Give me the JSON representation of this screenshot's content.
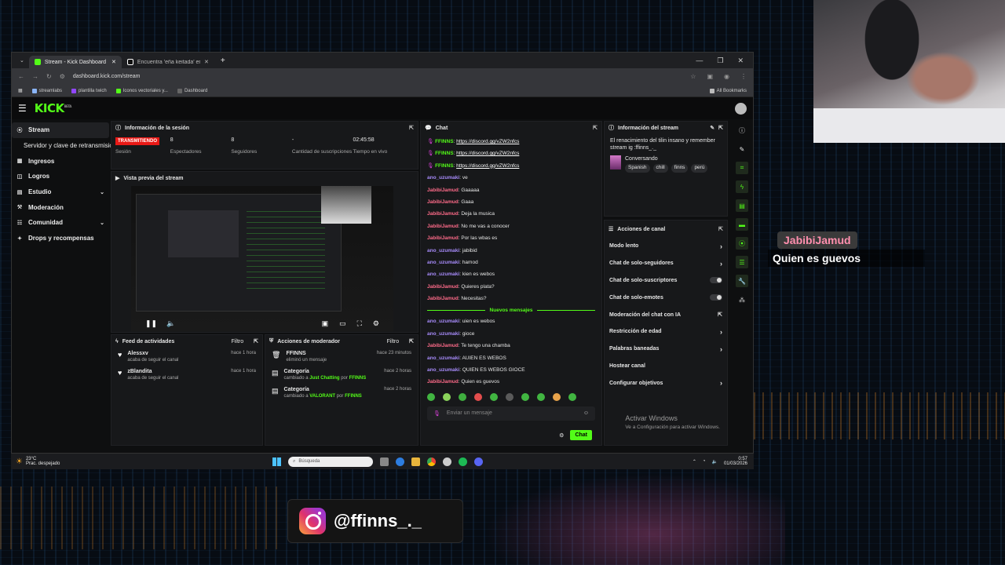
{
  "browser": {
    "tabs": [
      {
        "title": "Stream - Kick Dashboard",
        "active": true
      },
      {
        "title": "Encuentra 'eña keitada' en Tik",
        "active": false
      }
    ],
    "new_tab": "+",
    "url": "dashboard.kick.com/stream",
    "bookmarks": [
      "streamlabs",
      "plantilla twich",
      "Iconos vectoriales y...",
      "Dashboard"
    ],
    "all_bookmarks": "All Bookmarks"
  },
  "kick": {
    "logo": "KICK",
    "logo_badge": "BETA",
    "sidebar": [
      {
        "label": "Stream",
        "icon": "broadcast-icon",
        "active": true
      },
      {
        "label": "Servidor y clave de retransmisión",
        "sub": true
      },
      {
        "label": "Ingresos",
        "icon": "grid-icon"
      },
      {
        "label": "Logros",
        "icon": "trophy-icon"
      },
      {
        "label": "Estudio",
        "icon": "layout-icon",
        "expand": true
      },
      {
        "label": "Moderación",
        "icon": "gavel-icon"
      },
      {
        "label": "Comunidad",
        "icon": "group-icon",
        "expand": true
      },
      {
        "label": "Drops y recompensas",
        "icon": "gift-icon"
      }
    ],
    "session": {
      "title": "Información de la sesión",
      "status": "TRANSMITIENDO",
      "status_label": "Sesión",
      "stats": [
        {
          "value": "8",
          "label": "Espectadores"
        },
        {
          "value": "8",
          "label": "Seguidores"
        },
        {
          "value": "-",
          "label": "Cantidad de suscripciones"
        },
        {
          "value": "02:45:58",
          "label": "Tiempo en vivo"
        }
      ]
    },
    "preview": {
      "title": "Vista previa del stream"
    },
    "feed": {
      "title": "Feed de actividades",
      "filter": "Filtro",
      "items": [
        {
          "user": "Alessxv",
          "action": "acaba de seguir el canal",
          "time": "hace 1 hora"
        },
        {
          "user": "zBlandita",
          "action": "acaba de seguir el canal",
          "time": "hace 1 hora"
        }
      ]
    },
    "modactions": {
      "title": "Acciones de moderador",
      "filter": "Filtro",
      "items": [
        {
          "title": "FFINNS",
          "desc": "eliminó un mensaje",
          "time": "hace 23 minutos"
        },
        {
          "title": "Categoría",
          "desc_pre": "cambiado a ",
          "desc_hl": "Just Chatting",
          "desc_mid": " por ",
          "desc_by": "FFINNS",
          "time": "hace 2 horas"
        },
        {
          "title": "Categoría",
          "desc_pre": "cambiado a ",
          "desc_hl": "VALORANT",
          "desc_mid": " por ",
          "desc_by": "FFINNS",
          "time": "hace 2 horas"
        }
      ]
    },
    "chat": {
      "title": "Chat",
      "messages": [
        {
          "user": "FFINNS",
          "color": "#53fc18",
          "text": "https://discord.gg/vZW2nfcs",
          "link": true,
          "badge": true
        },
        {
          "user": "FFINNS",
          "color": "#53fc18",
          "text": "https://discord.gg/vZW2nfcs",
          "link": true,
          "badge": true
        },
        {
          "user": "FFINNS",
          "color": "#53fc18",
          "text": "https://discord.gg/vZW2nfcs",
          "link": true,
          "badge": true
        },
        {
          "user": "ano_uzumaki",
          "color": "#a78bfa",
          "text": "ve"
        },
        {
          "user": "JabibiJamud",
          "color": "#ff6b8a",
          "text": "Gaaaaa"
        },
        {
          "user": "JabibiJamud",
          "color": "#ff6b8a",
          "text": "Gaaa"
        },
        {
          "user": "JabibiJamud",
          "color": "#ff6b8a",
          "text": "Deja la musica"
        },
        {
          "user": "JabibiJamud",
          "color": "#ff6b8a",
          "text": "No me vas a conocer"
        },
        {
          "user": "JabibiJamud",
          "color": "#ff6b8a",
          "text": "Por las wbas es"
        },
        {
          "user": "ano_uzumaki",
          "color": "#a78bfa",
          "text": "jabibid"
        },
        {
          "user": "ano_uzumaki",
          "color": "#a78bfa",
          "text": "hamod"
        },
        {
          "user": "ano_uzumaki",
          "color": "#a78bfa",
          "text": "kien es webos"
        },
        {
          "user": "JabibiJamud",
          "color": "#ff6b8a",
          "text": "Quieres plata?"
        },
        {
          "user": "JabibiJamud",
          "color": "#ff6b8a",
          "text": "Necesitas?"
        }
      ],
      "new_label": "Nuevos mensajes",
      "new_messages": [
        {
          "user": "ano_uzumaki",
          "color": "#a78bfa",
          "text": "uien es webos"
        },
        {
          "user": "ano_uzumaki",
          "color": "#a78bfa",
          "text": "gioce"
        },
        {
          "user": "JabibiJamud",
          "color": "#ff6b8a",
          "text": "Te tengo una chamba"
        },
        {
          "user": "ano_uzumaki",
          "color": "#a78bfa",
          "text": "AUIEN ES WEBOS"
        },
        {
          "user": "ano_uzumaki",
          "color": "#a78bfa",
          "text": "QUIEN ES WEBOS GIOCE"
        },
        {
          "user": "JabibiJamud",
          "color": "#ff6b8a",
          "text": "Quien es guevos"
        }
      ],
      "placeholder": "Enviar un mensaje",
      "send": "Chat"
    },
    "streaminfo": {
      "title": "Información del stream",
      "stream_title": "El renacimiento del tilin insano y remember stream ig :ffinns_._",
      "category": "Conversando",
      "tags": [
        "Spanish",
        "chill",
        "finns",
        "perú"
      ]
    },
    "channel_actions": {
      "title": "Acciones de canal",
      "items": [
        {
          "label": "Modo lento",
          "type": "arrow"
        },
        {
          "label": "Chat de solo-seguidores",
          "type": "arrow"
        },
        {
          "label": "Chat de solo-suscriptores",
          "type": "toggle"
        },
        {
          "label": "Chat de solo-emotes",
          "type": "toggle"
        },
        {
          "label": "Moderación del chat con IA",
          "type": "external"
        },
        {
          "label": "Restricción de edad",
          "type": "arrow"
        },
        {
          "label": "Palabras baneadas",
          "type": "arrow"
        },
        {
          "label": "Hostear canal",
          "type": "none"
        },
        {
          "label": "Configurar objetivos",
          "type": "arrow"
        }
      ]
    },
    "activate": {
      "title": "Activar Windows",
      "sub": "Ve a Configuración para activar Windows."
    }
  },
  "taskbar": {
    "temp": "23°C",
    "weather": "Prac. despejado",
    "search": "Búsqueda",
    "time": "0:57",
    "date": "01/03/2026"
  },
  "overlay": {
    "user": "JabibiJamud",
    "message": "Quien es guevos",
    "instagram": "@ffinns_._"
  },
  "colors": {
    "kick_green": "#53fc18",
    "live_red": "#e91916"
  }
}
